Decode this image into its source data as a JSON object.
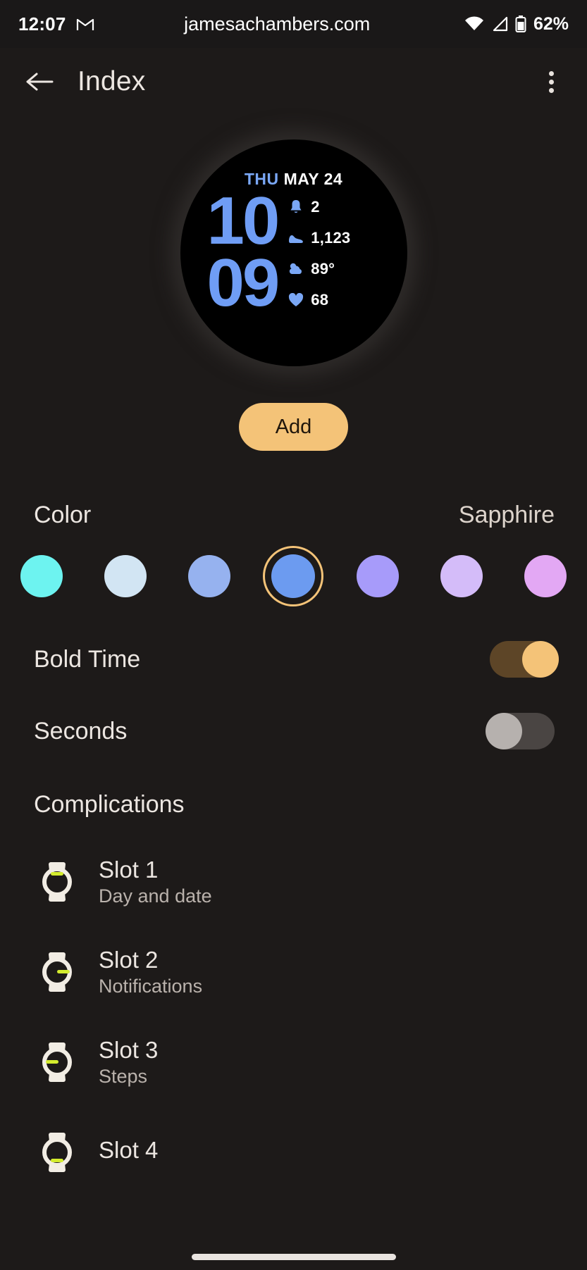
{
  "status_bar": {
    "clock": "12:07",
    "gmail_icon": "gmail-icon",
    "watermark": "jamesachambers.com",
    "wifi_icon": "wifi-icon",
    "signal_icon": "cell-signal-icon",
    "battery_icon": "battery-icon",
    "battery_text": "62%"
  },
  "app_bar": {
    "back_icon": "back-arrow-icon",
    "title": "Index",
    "overflow_icon": "overflow-menu-icon"
  },
  "watch_preview": {
    "day_of_week": "THU",
    "month_day": "MAY 24",
    "hours": "10",
    "minutes": "09",
    "day_color": "#7aa7f5",
    "time_color": "#6f9df5",
    "complications": [
      {
        "icon": "bell-icon",
        "value": "2"
      },
      {
        "icon": "shoe-steps-icon",
        "value": "1,123"
      },
      {
        "icon": "weather-partly-cloudy-icon",
        "value": "89°"
      },
      {
        "icon": "heart-icon",
        "value": "68"
      }
    ]
  },
  "add_button": {
    "label": "Add",
    "bg": "#f4c378"
  },
  "color_section": {
    "label": "Color",
    "value": "Sapphire",
    "selected_index": 3,
    "swatches": [
      {
        "name": "aqua",
        "hex": "#6df3f0"
      },
      {
        "name": "ice",
        "hex": "#d2e5f3"
      },
      {
        "name": "cornflower-light",
        "hex": "#96b2ef"
      },
      {
        "name": "sapphire",
        "hex": "#6c9bf0"
      },
      {
        "name": "periwinkle",
        "hex": "#a79bfa"
      },
      {
        "name": "lavender",
        "hex": "#d4bcf9"
      },
      {
        "name": "orchid",
        "hex": "#e3a8f4"
      }
    ]
  },
  "toggles": [
    {
      "name": "bold-time",
      "label": "Bold Time",
      "state": "on"
    },
    {
      "name": "seconds",
      "label": "Seconds",
      "state": "off"
    }
  ],
  "complications_section": {
    "title": "Complications",
    "slots": [
      {
        "icon": "watch-slot-icon",
        "title": "Slot 1",
        "subtitle": "Day and date",
        "marker": "top"
      },
      {
        "icon": "watch-slot-icon",
        "title": "Slot 2",
        "subtitle": "Notifications",
        "marker": "right"
      },
      {
        "icon": "watch-slot-icon",
        "title": "Slot 3",
        "subtitle": "Steps",
        "marker": "left"
      },
      {
        "icon": "watch-slot-icon",
        "title": "Slot 4",
        "subtitle": "",
        "marker": "bottom"
      }
    ]
  },
  "home_indicator": "home-gesture-bar"
}
